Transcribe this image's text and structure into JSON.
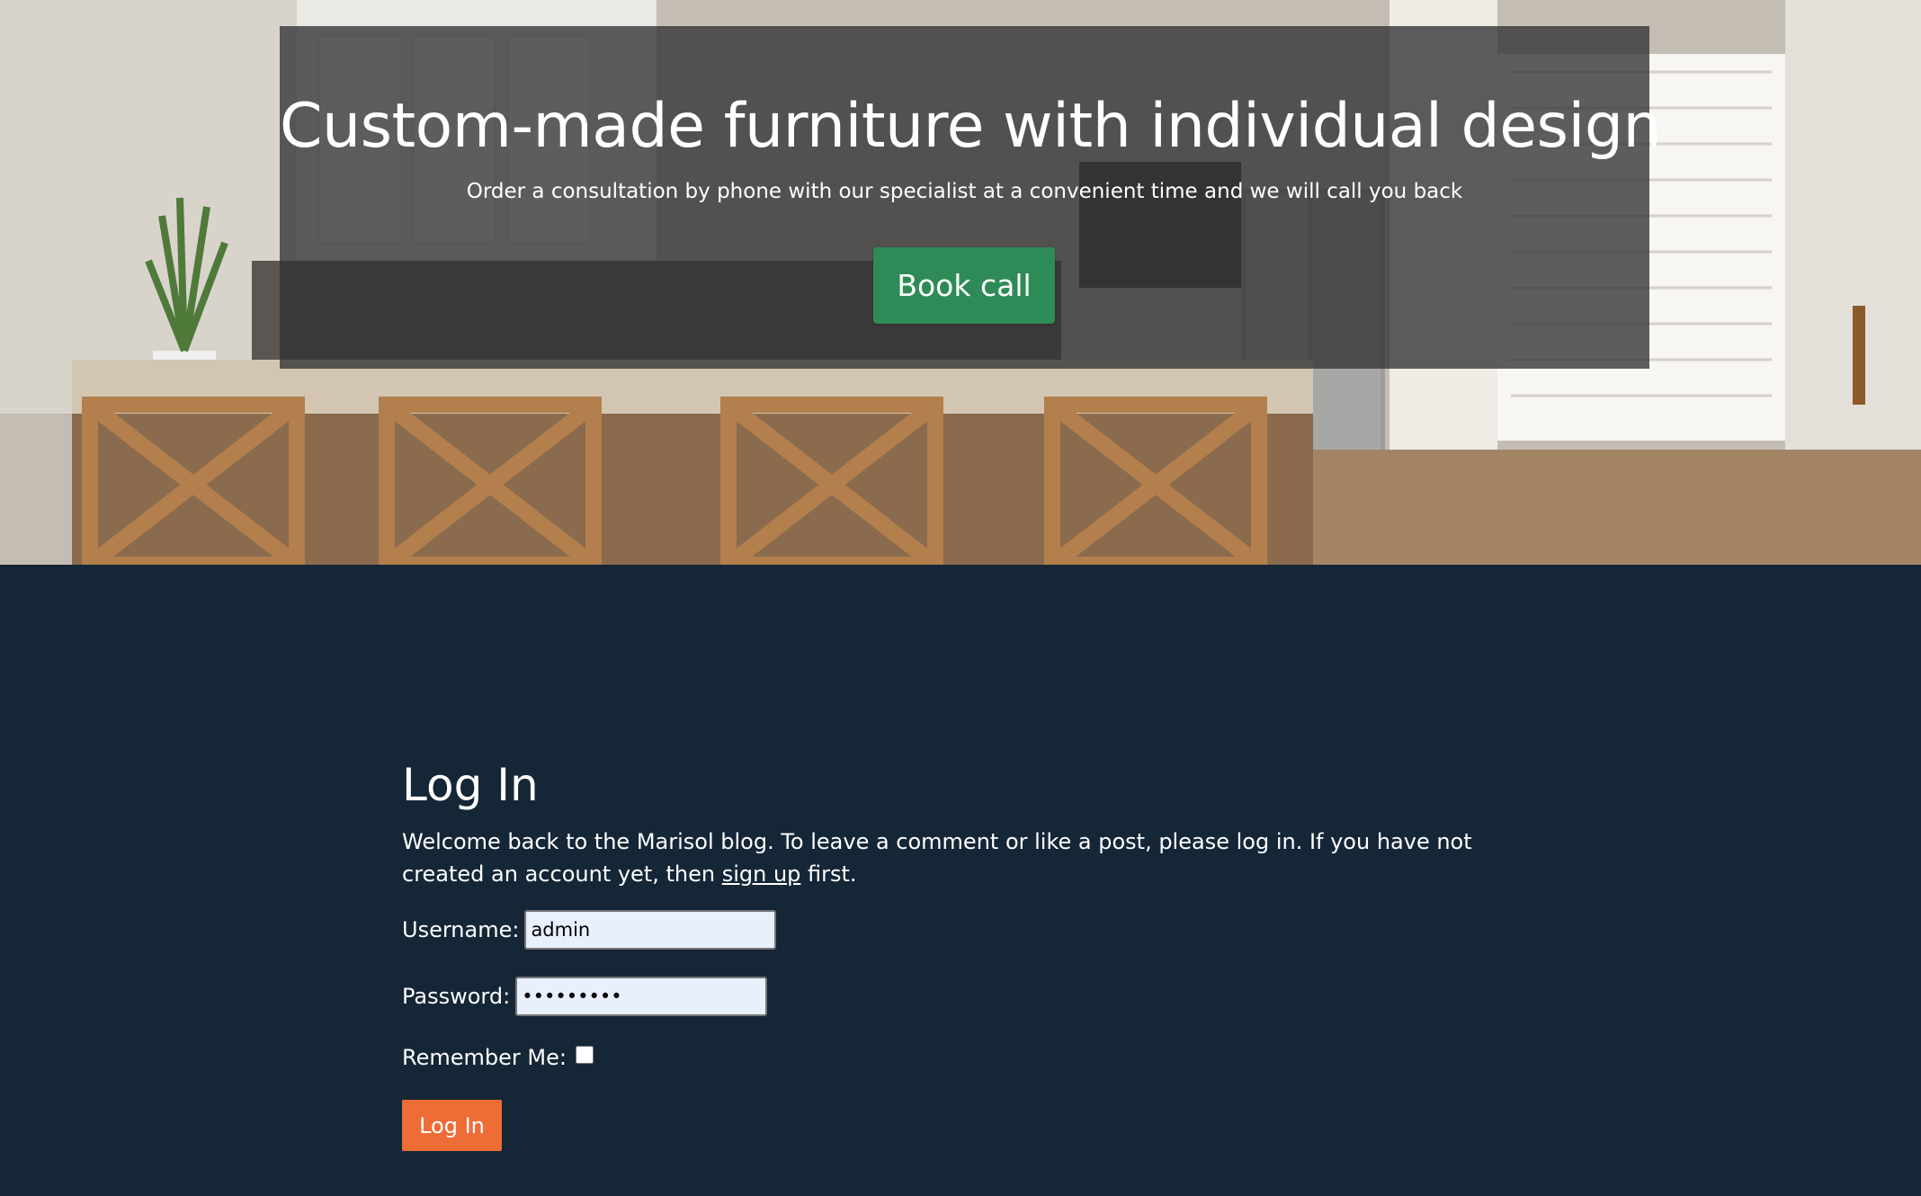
{
  "hero": {
    "title": "Custom-made furniture with individual design",
    "subtitle": "Order a consultation by phone with our specialist at a convenient time and we will call you back",
    "button_label": "Book call",
    "button_color": "#2e8b57"
  },
  "login": {
    "title": "Log In",
    "intro_before": "Welcome back to the Marisol blog. To leave a comment or like a post, please log in. If you have not created an account yet, then ",
    "intro_link": "sign up",
    "intro_after": " first.",
    "username_label": "Username:",
    "username_value": "admin",
    "password_label": "Password:",
    "password_value": "secretpwd",
    "remember_label": "Remember Me:",
    "remember_checked": false,
    "submit_label": "Log In",
    "submit_color": "#ee6d37"
  },
  "colors": {
    "page_background": "#152637",
    "hero_overlay": "rgba(50,50,52,0.78)"
  }
}
